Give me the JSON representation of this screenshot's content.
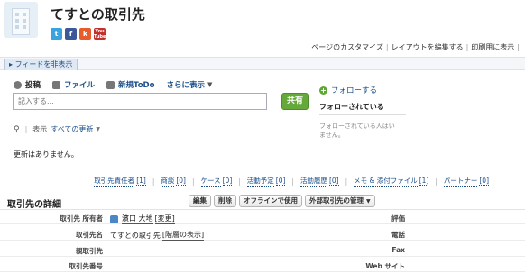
{
  "header": {
    "title": "てすとの取引先",
    "social": [
      {
        "name": "twitter",
        "glyph": "t"
      },
      {
        "name": "facebook",
        "glyph": "f"
      },
      {
        "name": "klout",
        "glyph": "k"
      },
      {
        "name": "youtube",
        "glyph": "You Tube"
      }
    ]
  },
  "toplinks": {
    "customize": "ページのカスタマイズ",
    "edit_layout": "レイアウトを編集する",
    "print": "印刷用に表示",
    "separator": "|"
  },
  "feed": {
    "toggle_label": "フィードを非表示"
  },
  "publisher": {
    "tabs": {
      "post": "投稿",
      "file": "ファイル",
      "todo": "新規ToDo",
      "more": "さらに表示"
    },
    "input_placeholder": "記入する...",
    "share_label": "共有"
  },
  "follow": {
    "button_label": "フォローする",
    "followed_title": "フォローされている",
    "followed_empty": "フォローされている人はいません。"
  },
  "filter": {
    "label": "表示",
    "value": "すべての更新"
  },
  "no_updates": "更新はありません。",
  "related_lists": [
    {
      "label": "取引先責任者",
      "count": "[1]"
    },
    {
      "label": "商談",
      "count": "[0]"
    },
    {
      "label": "ケース",
      "count": "[0]"
    },
    {
      "label": "活動予定",
      "count": "[0]"
    },
    {
      "label": "活動履歴",
      "count": "[0]"
    },
    {
      "label": "メモ & 添付ファイル",
      "count": "[1]"
    },
    {
      "label": "パートナー",
      "count": "[0]"
    }
  ],
  "detail": {
    "section_title": "取引先の詳細",
    "buttons": {
      "edit": "編集",
      "delete": "削除",
      "offline": "オフラインで使用",
      "external": "外部取引先の管理"
    },
    "rows": [
      {
        "label": "取引先 所有者",
        "value": "濱口 大地",
        "link": "[変更]",
        "right_label": "評価"
      },
      {
        "label": "取引先名",
        "value": "てすとの取引先",
        "link": "[階層の表示]",
        "right_label": "電話"
      },
      {
        "label": "親取引先",
        "value": "",
        "link": "",
        "right_label": "Fax"
      },
      {
        "label": "取引先番号",
        "value": "",
        "link": "",
        "right_label": "Web サイト"
      }
    ]
  },
  "colors": {
    "link": "#1a4f8a",
    "share": "#65a93a",
    "twitter": "#3aa3df",
    "facebook": "#3b5998",
    "youtube": "#c4302b"
  }
}
